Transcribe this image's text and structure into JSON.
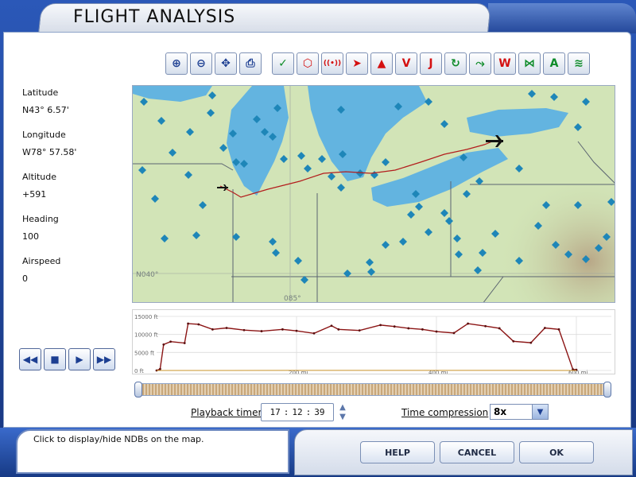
{
  "window": {
    "title": "FLIGHT ANALYSIS"
  },
  "toolbar": {
    "view_buttons": [
      {
        "name": "zoom-in-icon",
        "glyph": "⊕"
      },
      {
        "name": "zoom-out-icon",
        "glyph": "⊖"
      },
      {
        "name": "center-icon",
        "glyph": "✥"
      },
      {
        "name": "print-icon",
        "glyph": "⎙"
      }
    ],
    "filter_buttons": [
      {
        "name": "airports-icon",
        "glyph": "✓",
        "color": "green"
      },
      {
        "name": "vor-icon",
        "glyph": "⬡",
        "color": "red"
      },
      {
        "name": "ndb-icon",
        "glyph": "((•))",
        "color": "red"
      },
      {
        "name": "direction-icon",
        "glyph": "➤",
        "color": "red"
      },
      {
        "name": "warning-icon",
        "glyph": "▲",
        "color": "red"
      },
      {
        "name": "victor-airways-icon",
        "glyph": "V",
        "color": "red"
      },
      {
        "name": "jet-airways-icon",
        "glyph": "J",
        "color": "red"
      },
      {
        "name": "recycle-icon",
        "glyph": "↻",
        "color": "green"
      },
      {
        "name": "path-icon",
        "glyph": "⤳",
        "color": "green"
      },
      {
        "name": "waypoints-icon",
        "glyph": "W",
        "color": "red"
      },
      {
        "name": "boundaries-icon",
        "glyph": "⋈",
        "color": "green"
      },
      {
        "name": "labels-icon",
        "glyph": "A",
        "color": "green"
      },
      {
        "name": "terrain-icon",
        "glyph": "≋",
        "color": "green"
      }
    ]
  },
  "info": {
    "latitude_label": "Latitude",
    "latitude_value": "N43° 6.57'",
    "longitude_label": "Longitude",
    "longitude_value": "W78° 57.58'",
    "altitude_label": "Altitude",
    "altitude_value": "+591",
    "heading_label": "Heading",
    "heading_value": "100",
    "airspeed_label": "Airspeed",
    "airspeed_value": "0"
  },
  "map": {
    "grid_labels": [
      "N040°",
      "085°"
    ]
  },
  "chart_data": {
    "type": "line",
    "y_ticks": [
      "15000 ft",
      "10000 ft",
      "5000 ft",
      "0 ft"
    ],
    "x_ticks": [
      "200 mi",
      "400 mi",
      "600 mi"
    ],
    "ylim": [
      0,
      15000
    ],
    "xlim": [
      0,
      650
    ],
    "series": [
      {
        "color": "#8b1414",
        "x": [
          0,
          5,
          10,
          20,
          40,
          45,
          60,
          80,
          100,
          125,
          150,
          180,
          200,
          225,
          250,
          260,
          290,
          320,
          340,
          360,
          380,
          400,
          425,
          445,
          470,
          490,
          510,
          535,
          555,
          575,
          595,
          600
        ],
        "y": [
          0,
          400,
          7200,
          8000,
          7600,
          13000,
          12800,
          11400,
          11800,
          11200,
          10900,
          11400,
          11000,
          10300,
          12400,
          11400,
          11100,
          12600,
          12200,
          11700,
          11400,
          10800,
          10400,
          13000,
          12300,
          11700,
          8100,
          7700,
          11800,
          11400,
          300,
          200
        ]
      },
      {
        "color": "#c9932a",
        "x": [
          0,
          100,
          200,
          300,
          400,
          500,
          600
        ],
        "y": [
          0,
          0,
          20,
          40,
          30,
          20,
          0
        ]
      }
    ]
  },
  "playback": {
    "timer_label": "Playback timer",
    "hours": "17",
    "minutes": "12",
    "seconds": "39",
    "compression_label": "Time compression",
    "compression_value": "8x"
  },
  "status": {
    "text": "Click to display/hide NDBs on the map."
  },
  "buttons": {
    "help": "HELP",
    "cancel": "CANCEL",
    "ok": "OK"
  }
}
